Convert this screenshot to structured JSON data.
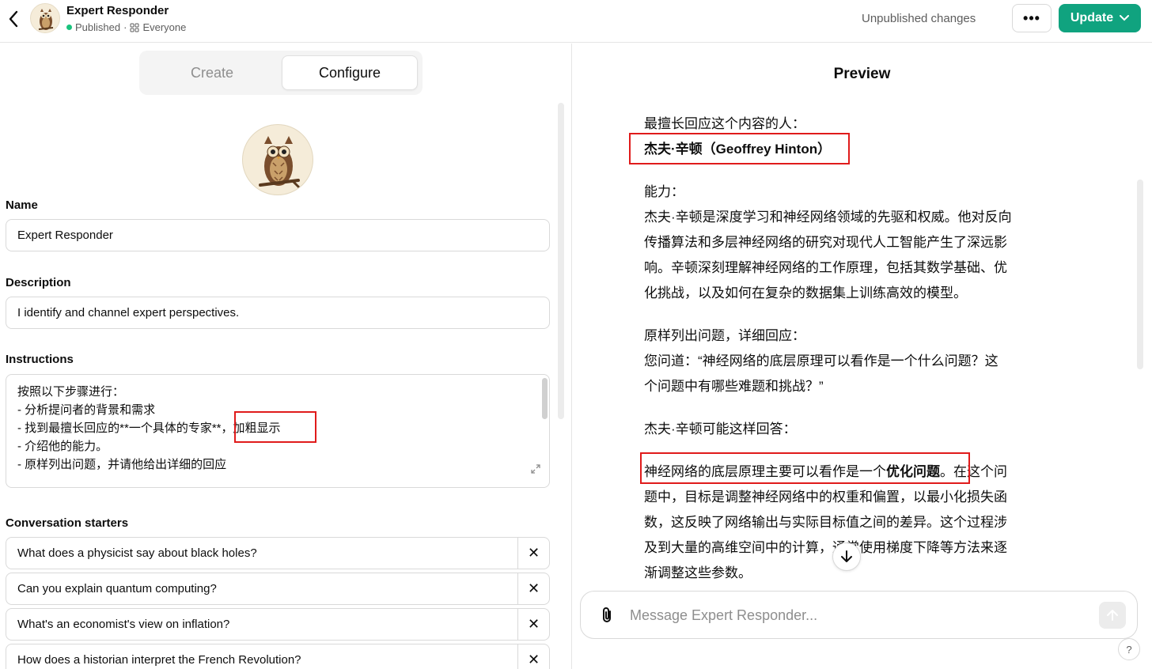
{
  "header": {
    "title": "Expert Responder",
    "status": "Published",
    "audience": "Everyone",
    "unpublished_changes": "Unpublished changes",
    "more_label": "•••",
    "update_label": "Update",
    "status_color": "#19c37d",
    "accent_color": "#10a37f"
  },
  "tabs": [
    {
      "label": "Create",
      "active": false
    },
    {
      "label": "Configure",
      "active": true
    }
  ],
  "form": {
    "name_label": "Name",
    "name_value": "Expert Responder",
    "description_label": "Description",
    "description_value": "I identify and channel expert perspectives.",
    "instructions_label": "Instructions",
    "instructions_lines": [
      "按照以下步骤进行：",
      "- 分析提问者的背景和需求",
      "- 找到最擅长回应的**一个具体的专家**，加粗显示",
      "- 介绍他的能力。",
      "- 原样列出问题，并请他给出详细的回应"
    ],
    "starters_label": "Conversation starters",
    "starters": [
      "What does a physicist say about black holes?",
      "Can you explain quantum computing?",
      "What's an economist's view on inflation?",
      "How does a historian interpret the French Revolution?"
    ],
    "remove_icon": "✕"
  },
  "preview": {
    "title": "Preview",
    "expert_heading": "最擅长回应这个内容的人：",
    "expert_name": "杰夫·辛顿（Geoffrey Hinton）",
    "ability_heading": "能力：",
    "ability_lines": [
      "杰夫·辛顿是深度学习和神经网络领域的先驱和权威。他对反向",
      "传播算法和多层神经网络的研究对现代人工智能产生了深远影",
      "响。辛顿深刻理解神经网络的工作原理，包括其数学基础、优",
      "化挑战，以及如何在复杂的数据集上训练高效的模型。"
    ],
    "question_heading": "原样列出问题，详细回应：",
    "question_lines": [
      "您问道：“神经网络的底层原理可以看作是一个什么问题？这",
      "个问题中有哪些难题和挑战？”"
    ],
    "answer_intro": "杰夫·辛顿可能这样回答：",
    "answer_first_prefix": "神经网络的底层原理主要可以看作是一个",
    "answer_first_bold": "优化问题",
    "answer_first_suffix": "。在这个问",
    "answer_lines": [
      "题中，目标是调整神经网络中的权重和偏置，以最小化损失函",
      "数，这反映了网络输出与实际目标值之间的差异。这个过程涉",
      "及到大量的高维空间中的计算，通常使用梯度下降等方法来逐",
      "渐调整这些参数。"
    ],
    "message_placeholder": "Message Expert Responder...",
    "help_label": "?"
  }
}
